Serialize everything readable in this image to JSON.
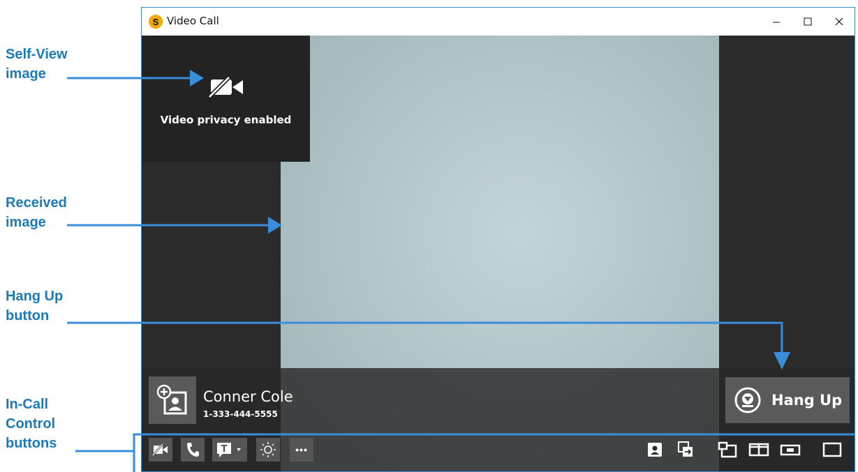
{
  "callouts": {
    "self_view": "Self-View\nimage",
    "received": "Received\nimage",
    "hang_up": "Hang Up\nbutton",
    "in_call": "In-Call\nControl\nbuttons"
  },
  "window": {
    "title": "Video Call",
    "logo_letter": "S"
  },
  "self_view": {
    "privacy_text": "Video privacy enabled"
  },
  "caller": {
    "name": "Conner Cole",
    "number": "1-333-444-5555"
  },
  "hang_up": {
    "label": "Hang Up"
  },
  "toolbar": {
    "left_icons": [
      "video-privacy-icon",
      "phone-icon",
      "text-icon",
      "brightness-icon",
      "more-icon"
    ],
    "right_icons": [
      "contact-card-icon",
      "share-icon",
      "layout-pip-icon",
      "layout-side-by-side-icon",
      "layout-small-icon",
      "layout-full-icon"
    ],
    "more_label": "•••"
  },
  "colors": {
    "accent": "#1b7ab8",
    "arrow": "#3a8ddb",
    "logo": "#f5a800",
    "button_bg": "#5a5a5a"
  }
}
